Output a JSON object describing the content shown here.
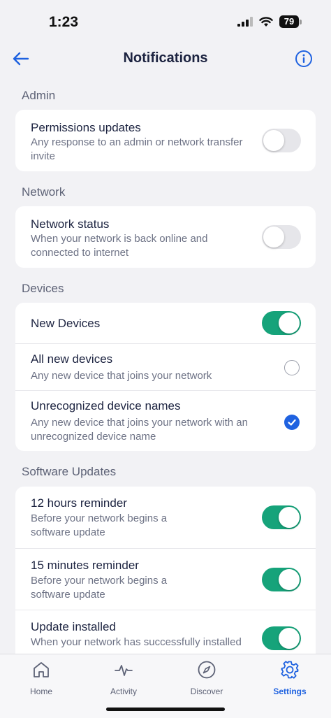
{
  "status_bar": {
    "time": "1:23",
    "battery": "79"
  },
  "header": {
    "title": "Notifications"
  },
  "sections": {
    "admin": {
      "header": "Admin",
      "permissions": {
        "title": "Permissions updates",
        "desc": "Any response to an admin or network transfer invite",
        "enabled": false
      }
    },
    "network": {
      "header": "Network",
      "status": {
        "title": "Network status",
        "desc": "When your network is back online and connected to internet",
        "enabled": false
      }
    },
    "devices": {
      "header": "Devices",
      "new_devices": {
        "title": "New Devices",
        "enabled": true
      },
      "all_new": {
        "title": "All new devices",
        "desc": "Any new device that joins your network",
        "selected": false
      },
      "unrecognized": {
        "title": "Unrecognized device names",
        "desc": "Any new device that joins your network with an unrecognized device name",
        "selected": true
      }
    },
    "software": {
      "header": "Software Updates",
      "reminder_12h": {
        "title": "12 hours reminder",
        "desc": "Before your network begins a software update",
        "enabled": true
      },
      "reminder_15m": {
        "title": "15 minutes reminder",
        "desc": "Before your network begins a software update",
        "enabled": true
      },
      "installed": {
        "title": "Update installed",
        "desc": "When your network has successfully installed",
        "enabled": true
      }
    }
  },
  "tab_bar": {
    "items": [
      {
        "label": "Home",
        "icon": "home-icon"
      },
      {
        "label": "Activity",
        "icon": "activity-icon"
      },
      {
        "label": "Discover",
        "icon": "compass-icon"
      },
      {
        "label": "Settings",
        "icon": "gear-icon"
      }
    ],
    "active": "Settings"
  },
  "colors": {
    "accent": "#1f62e0",
    "toggle_on": "#16a37a",
    "background": "#f2f2f5"
  }
}
